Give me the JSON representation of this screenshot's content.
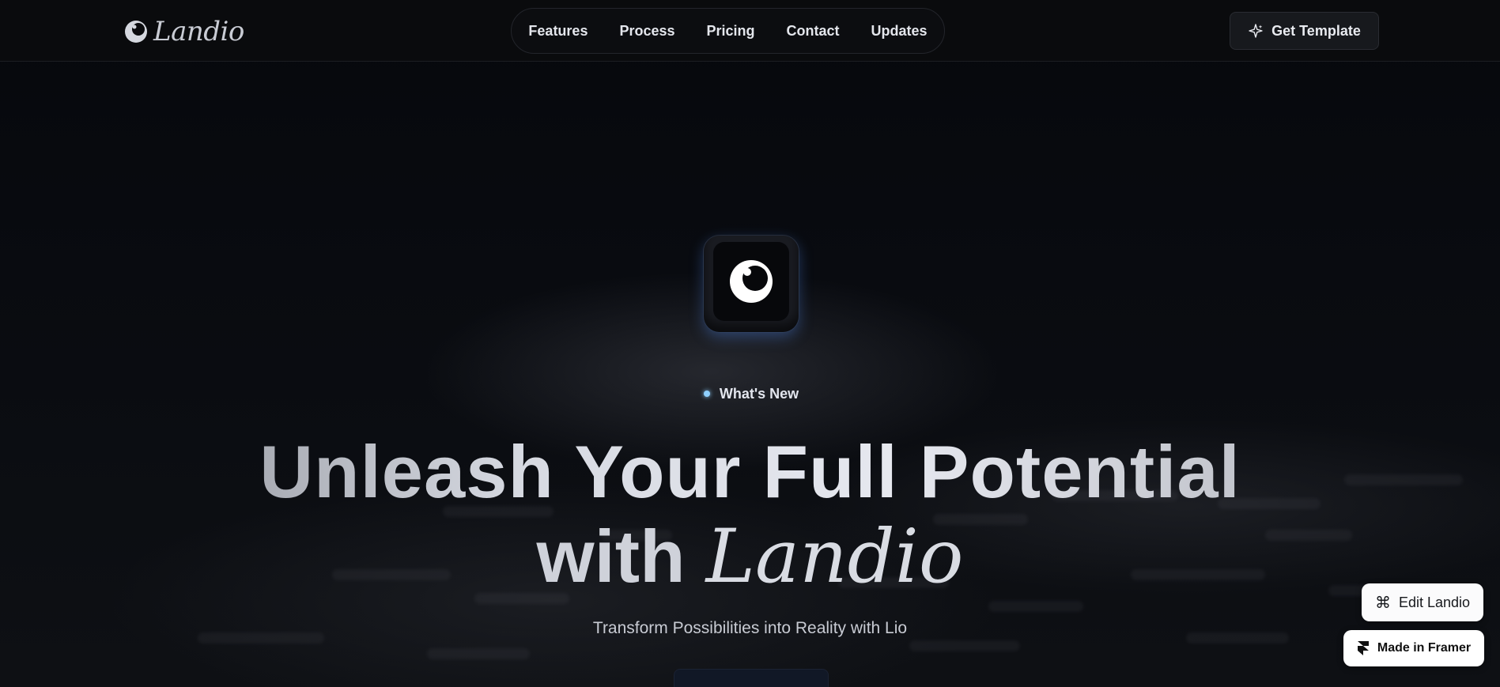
{
  "brand": {
    "name": "Landio",
    "logo_icon": "orb-logo-icon"
  },
  "nav": {
    "links": [
      "Features",
      "Process",
      "Pricing",
      "Contact",
      "Updates"
    ],
    "cta_label": "Get Template",
    "cta_icon": "sparkle-icon"
  },
  "hero": {
    "app_icon": "orb-logo-icon",
    "badge_label": "What's New",
    "headline_line1": "Unleash Your Full Potential",
    "headline_line2_plain": "with",
    "headline_line2_script": "Landio",
    "subheadline": "Transform Possibilities into Reality with Lio"
  },
  "floating": {
    "edit_label": "Edit Landio",
    "edit_icon": "command-icon",
    "framer_label": "Made in Framer",
    "framer_icon": "framer-icon"
  },
  "colors": {
    "background": "#0a0b0d",
    "accent_dot": "#8fd0ff",
    "icon_glow": "#5a96ff"
  }
}
